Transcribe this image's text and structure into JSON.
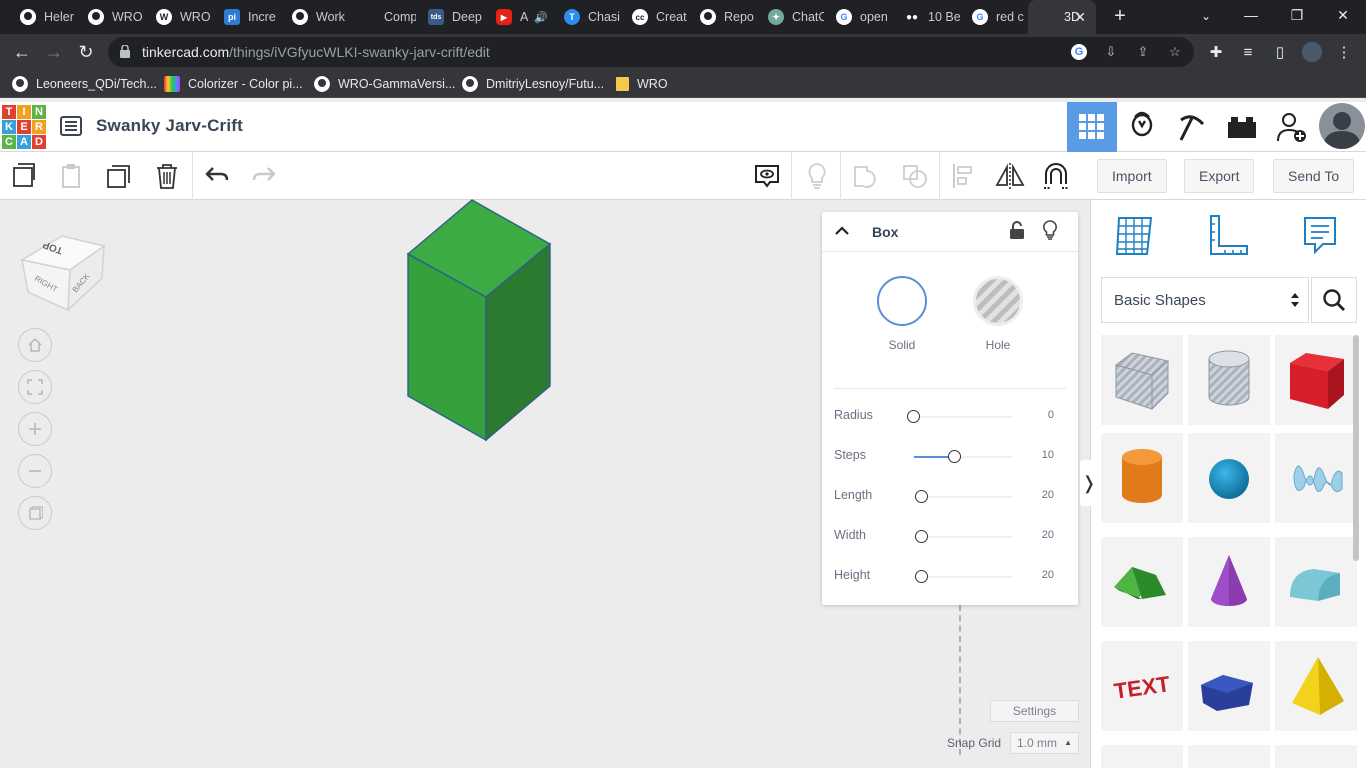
{
  "browser": {
    "tabs": [
      {
        "label": "Heler",
        "icon": "github-icon",
        "color": "#ffffff"
      },
      {
        "label": "WRO",
        "icon": "github-icon",
        "color": "#ffffff"
      },
      {
        "label": "WRO",
        "icon": "wordpress-icon",
        "color": "#ffffff"
      },
      {
        "label": "Incre",
        "icon": "pi-icon",
        "color": "#2e7bd6"
      },
      {
        "label": "Work",
        "icon": "github-icon",
        "color": "#ffffff"
      },
      {
        "label": "Comp",
        "icon": "blank-icon",
        "color": "#202124"
      },
      {
        "label": "Deep",
        "icon": "tds-icon",
        "color": "#3a5a8a"
      },
      {
        "label": "A",
        "icon": "youtube-icon",
        "color": "#e62117"
      },
      {
        "label": "Chasi",
        "icon": "translate-icon",
        "color": "#2a8bf2"
      },
      {
        "label": "Creat",
        "icon": "cc-icon",
        "color": "#ffffff"
      },
      {
        "label": "Repo",
        "icon": "github-icon",
        "color": "#ffffff"
      },
      {
        "label": "ChatC",
        "icon": "openai-icon",
        "color": "#74aa9c"
      },
      {
        "label": "open",
        "icon": "google-icon",
        "color": "#ffffff"
      },
      {
        "label": "10 Be",
        "icon": "medium-icon",
        "color": "#ffffff"
      },
      {
        "label": "red c",
        "icon": "google-icon",
        "color": "#ffffff"
      },
      {
        "label": "3D",
        "icon": "tinkercad-icon",
        "color": "#e05a3a"
      }
    ],
    "url_domain": "tinkercad.com",
    "url_path": "/things/iVGfyucWLKI-swanky-jarv-crift/edit",
    "bookmarks": [
      {
        "label": "Leoneers_QDi/Tech...",
        "icon": "github-icon"
      },
      {
        "label": "Colorizer - Color pi...",
        "icon": "colorizer-icon"
      },
      {
        "label": "WRO-GammaVersi...",
        "icon": "github-icon"
      },
      {
        "label": "DmitriyLesnoy/Futu...",
        "icon": "github-icon"
      },
      {
        "label": "WRO",
        "icon": "folder-icon"
      }
    ]
  },
  "app": {
    "design_title": "Swanky Jarv-Crift",
    "logo_letters": [
      "T",
      "I",
      "N",
      "K",
      "E",
      "R",
      "C",
      "A",
      "D"
    ]
  },
  "actions": {
    "import_label": "Import",
    "export_label": "Export",
    "send_to_label": "Send To"
  },
  "viewcube": {
    "top": "TOP",
    "right": "RIGHT",
    "back": "BACK"
  },
  "inspector": {
    "title": "Box",
    "solid_label": "Solid",
    "hole_label": "Hole",
    "props": [
      {
        "label": "Radius",
        "value": "0",
        "level": 0.0
      },
      {
        "label": "Steps",
        "value": "10",
        "level": 0.42
      },
      {
        "label": "Length",
        "value": "20",
        "level": 0.08
      },
      {
        "label": "Width",
        "value": "20",
        "level": 0.08
      },
      {
        "label": "Height",
        "value": "20",
        "level": 0.08
      }
    ]
  },
  "workplane": {
    "settings_label": "Settings",
    "snap_label": "Snap Grid",
    "snap_value": "1.0 mm"
  },
  "shapes_panel": {
    "library": "Basic Shapes",
    "shapes": [
      "box-hole",
      "cylinder-hole",
      "box",
      "cylinder",
      "sphere",
      "scribble",
      "roof",
      "cone",
      "round-roof",
      "text",
      "polygon",
      "pyramid"
    ]
  },
  "colors": {
    "box_top": "#3dab44",
    "box_left": "#36a03d",
    "box_right": "#2b7a30",
    "accent": "#5a9be6"
  }
}
